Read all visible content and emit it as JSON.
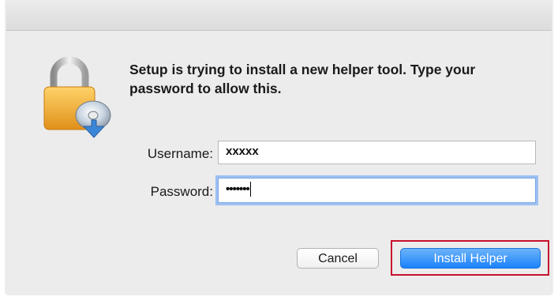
{
  "dialog": {
    "message": "Setup is trying to install a new helper tool. Type your password to allow this.",
    "username_label": "Username:",
    "username_value": "xxxxx",
    "password_label": "Password:",
    "password_masked": "•••••••",
    "cancel_label": "Cancel",
    "install_label": "Install Helper",
    "icon": "lock-with-disc-icon"
  },
  "colors": {
    "primary_button": "#1a82fb",
    "focus_ring": "#9cc0f2",
    "highlight_outline": "#c8102e",
    "lock_body": "#f0a830"
  }
}
